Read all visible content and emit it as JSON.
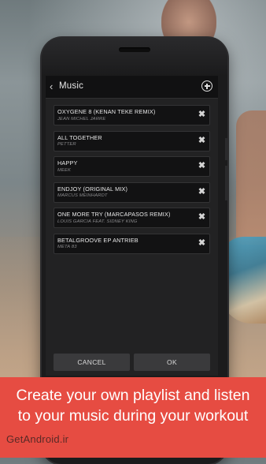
{
  "screen": {
    "title": "Music",
    "back_icon": "chevron-left-icon",
    "add_icon": "add-circle-icon"
  },
  "tracks": [
    {
      "title": "OXYGENE 8 (KENAN TEKE REMIX)",
      "artist": "JEAN MICHEL JARRE"
    },
    {
      "title": "ALL TOGETHER",
      "artist": "PETTER"
    },
    {
      "title": "HAPPY",
      "artist": "MEEK"
    },
    {
      "title": "ENDJOY (ORIGINAL MIX)",
      "artist": "MARCUS MEINHARDT"
    },
    {
      "title": "ONE MORE TRY (MARCAPASOS REMIX)",
      "artist": "LOUIS GARCIA FEAT. SIDNEY KING"
    },
    {
      "title": "BETALGROOVE EP ANTRIEB",
      "artist": "META 83"
    }
  ],
  "remove_icon": "close-icon",
  "buttons": {
    "cancel": "CANCEL",
    "ok": "OK"
  },
  "banner": {
    "text": "Create your own playlist and listen to your music during your workout",
    "color": "#e64c42"
  },
  "watermark": "GetAndroid.ir"
}
